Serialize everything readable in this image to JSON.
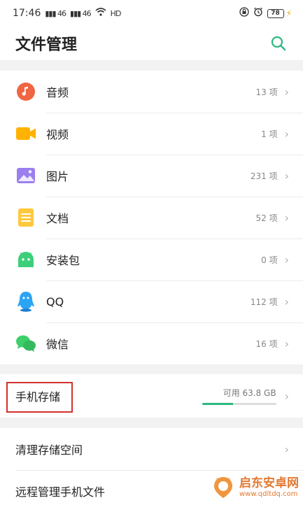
{
  "status_bar": {
    "time": "17:46",
    "signal_1": "46",
    "signal_2": "46",
    "network_label": "HD",
    "battery": "78"
  },
  "header": {
    "title": "文件管理"
  },
  "categories": [
    {
      "label": "音频",
      "count": "13 项",
      "icon": "music-icon",
      "color": "#f06543"
    },
    {
      "label": "视频",
      "count": "1 项",
      "icon": "video-icon",
      "color": "#ffb300"
    },
    {
      "label": "图片",
      "count": "231 项",
      "icon": "image-icon",
      "color": "#9b7ff0"
    },
    {
      "label": "文档",
      "count": "52 项",
      "icon": "document-icon",
      "color": "#ffc83d"
    },
    {
      "label": "安装包",
      "count": "0 项",
      "icon": "android-icon",
      "color": "#3ccf7a"
    },
    {
      "label": "QQ",
      "count": "112 项",
      "icon": "qq-icon",
      "color": "#2aa4f4"
    },
    {
      "label": "微信",
      "count": "16 项",
      "icon": "wechat-icon",
      "color": "#3fcf6a"
    }
  ],
  "storage": {
    "label": "手机存储",
    "free": "可用 63.8 GB",
    "used_fraction": 0.42,
    "accent": "#2db880"
  },
  "tools": [
    {
      "label": "清理存储空间"
    },
    {
      "label": "远程管理手机文件"
    }
  ],
  "watermark": {
    "title": "启东安卓网",
    "url": "www.qdltdq.com"
  }
}
